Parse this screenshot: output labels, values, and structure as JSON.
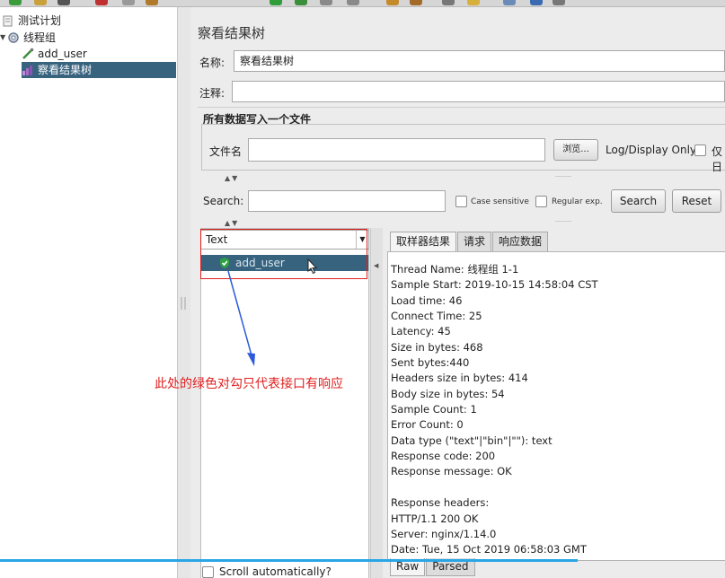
{
  "tree": {
    "items": [
      {
        "label": "测试计划",
        "icon": "test-plan-icon"
      },
      {
        "label": "线程组",
        "icon": "gear-icon"
      },
      {
        "label": "add_user",
        "icon": "pipette-icon"
      },
      {
        "label": "察看结果树",
        "icon": "chart-icon"
      }
    ]
  },
  "panel": {
    "title": "察看结果树",
    "name_label": "名称:",
    "name_value": "察看结果树",
    "comment_label": "注释:",
    "comment_value": "",
    "file_group_title": "所有数据写入一个文件",
    "filename_label": "文件名",
    "filename_value": "",
    "browse_label": "浏览...",
    "log_display_label": "Log/Display Only:",
    "errors_only_label": "仅日"
  },
  "search": {
    "label": "Search:",
    "value": "",
    "case_sensitive_label": "Case sensitive",
    "regex_label": "Regular exp.",
    "search_button": "Search",
    "reset_button": "Reset"
  },
  "results": {
    "renderer_selected": "Text",
    "items": [
      {
        "label": "add_user",
        "status": "success"
      }
    ],
    "scroll_auto_label": "Scroll automatically?"
  },
  "detail": {
    "tabs": [
      "取样器结果",
      "请求",
      "响应数据"
    ],
    "active_tab": 0,
    "lines": [
      "Thread Name: 线程组 1-1",
      "Sample Start: 2019-10-15 14:58:04 CST",
      "Load time: 46",
      "Connect Time: 25",
      "Latency: 45",
      "Size in bytes: 468",
      "Sent bytes:440",
      "Headers size in bytes: 414",
      "Body size in bytes: 54",
      "Sample Count: 1",
      "Error Count: 0",
      "Data type (\"text\"|\"bin\"|\"\"): text",
      "Response code: 200",
      "Response message: OK",
      "",
      "Response headers:",
      "HTTP/1.1 200 OK",
      "Server: nginx/1.14.0",
      "Date: Tue, 15 Oct 2019 06:58:03 GMT"
    ],
    "bottom_tabs": [
      "Raw",
      "Parsed"
    ],
    "active_bottom_tab": 0
  },
  "annotation": {
    "text": "此处的绿色对勾只代表接口有响应",
    "color": "#e02020"
  },
  "colors": {
    "selection": "#38637f",
    "success_check": "#2ea043"
  }
}
